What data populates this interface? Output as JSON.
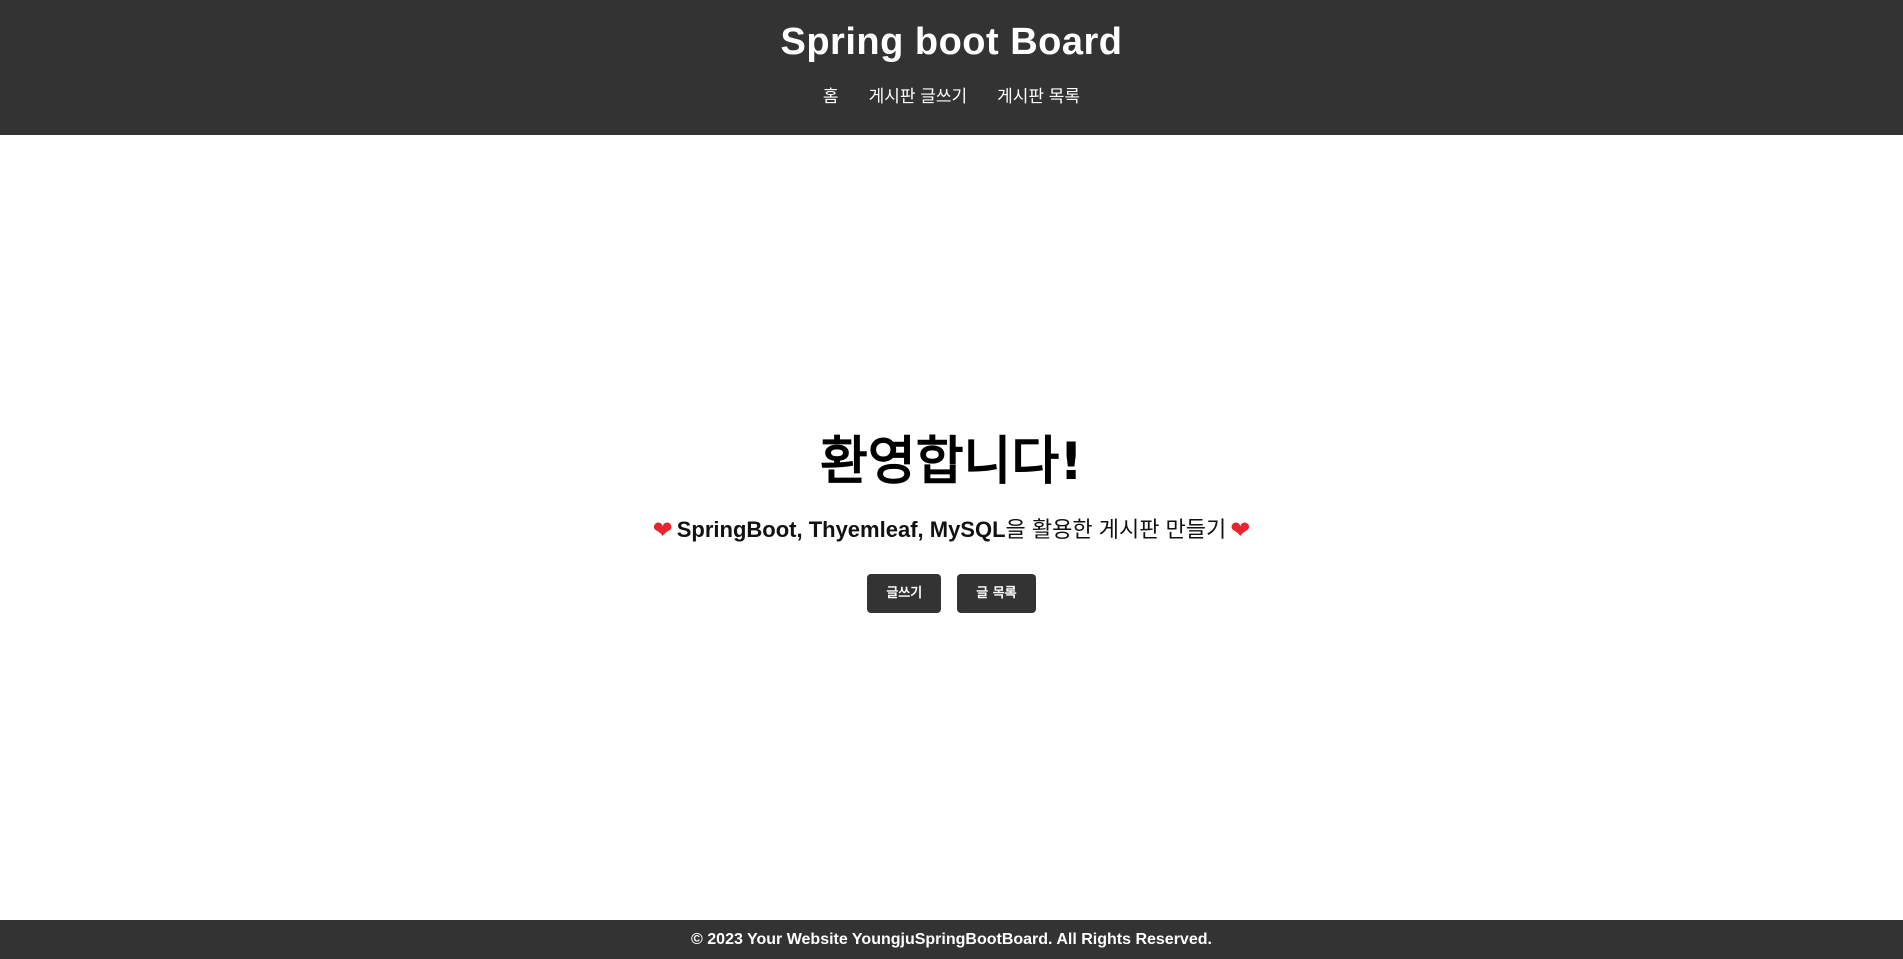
{
  "header": {
    "title": "Spring boot Board",
    "nav": [
      {
        "label": "홈"
      },
      {
        "label": "게시판 글쓰기"
      },
      {
        "label": "게시판 목록"
      }
    ]
  },
  "main": {
    "heading": "환영합니다!",
    "subtitle_strong": "SpringBoot, Thyemleaf, MySQL",
    "subtitle_rest": "을 활용한 게시판 만들기",
    "heart_glyph": "❤",
    "buttons": {
      "write_label": "글쓰기",
      "list_label": "글 목록"
    }
  },
  "footer": {
    "text": "© 2023 Your Website YoungjuSpringBootBoard. All Rights Reserved."
  },
  "colors": {
    "header_bg": "#333333",
    "footer_bg": "#333333",
    "button_bg": "#333333",
    "heart": "#e8242f"
  }
}
